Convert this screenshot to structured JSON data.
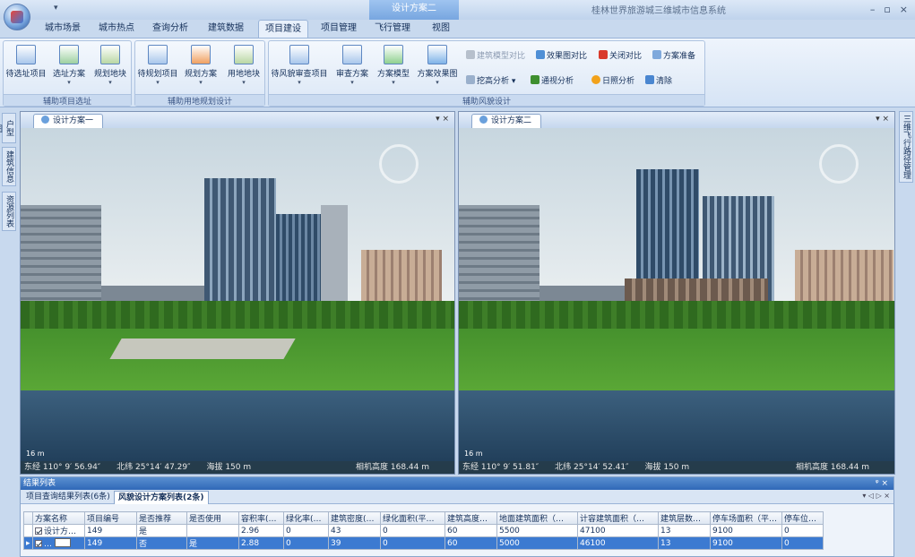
{
  "title_bar": {
    "context_tab": "设计方案二",
    "app_title": "桂林世界旅游城三维城市信息系统",
    "controls": [
      "–",
      "▫",
      "×"
    ],
    "qat_glyph": "▾"
  },
  "ribbon_tabs": [
    "城市场景",
    "城市热点",
    "查询分析",
    "建筑数据",
    "项目建设",
    "项目管理",
    "飞行管理",
    "视图"
  ],
  "active_tab": "项目建设",
  "groups": [
    {
      "label": "辅助项目选址",
      "buttons": [
        "待选址项目",
        "选址方案",
        "规划地块"
      ]
    },
    {
      "label": "辅助用地规划设计",
      "buttons": [
        "待规划项目",
        "规划方案",
        "用地地块"
      ]
    },
    {
      "label": "辅助风貌设计",
      "buttons": [
        "待风貌审查项目",
        "审查方案",
        "方案模型",
        "方案效果图"
      ]
    }
  ],
  "small_buttons": {
    "model_compare": "建筑模型对比",
    "effect_compare": "效果图对比",
    "close_compare": "关闭对比",
    "prepare": "方案准备",
    "cutfill": "挖高分析",
    "visibility": "通视分析",
    "sunlight": "日照分析",
    "clear": "清除"
  },
  "left_tabs": [
    "户型图",
    "建筑信息",
    "资源列表"
  ],
  "right_tab": "三维飞行路径管理",
  "panes": [
    {
      "tab_label": "设计方案一",
      "controls": "▾ ×",
      "scale": "16 m",
      "status": {
        "lon": "东经 110° 9′ 56.94″",
        "lat": "北纬 25°14′ 47.29″",
        "alt": "海拔 150 m",
        "cam": "相机高度 168.44 m"
      }
    },
    {
      "tab_label": "设计方案二",
      "controls": "▾ ×",
      "scale": "16 m",
      "status": {
        "lon": "东经 110° 9′ 51.81″",
        "lat": "北纬 25°14′ 52.41″",
        "alt": "海拔 150 m",
        "cam": "相机高度 168.44 m"
      }
    }
  ],
  "results": {
    "header": "结果列表",
    "pin": "ᵠ ×",
    "tabs": [
      "项目查询结果列表(6条)",
      "风貌设计方案列表(2条)"
    ],
    "active_tab": "风貌设计方案列表(2条)",
    "tab_nav": "▾ ◁ ▷ ×",
    "columns": [
      "方案名称",
      "项目编号",
      "是否推荐",
      "是否使用",
      "容积率(…",
      "绿化率(…",
      "建筑密度(…",
      "绿化面积(平…",
      "建筑高度…",
      "地面建筑面积（…",
      "计容建筑面积（…",
      "建筑层数…",
      "停车场面积（平…",
      "停车位…"
    ],
    "rows": [
      {
        "cells": [
          "设计方…",
          "149",
          "是",
          "",
          "2.96",
          "0",
          "43",
          "0",
          "60",
          "5500",
          "47100",
          "13",
          "9100",
          "0"
        ],
        "checked": true,
        "selected": false
      },
      {
        "cells": [
          "…",
          "149",
          "否",
          "是",
          "2.88",
          "0",
          "39",
          "0",
          "60",
          "5000",
          "46100",
          "13",
          "9100",
          "0"
        ],
        "checked": true,
        "selected": true
      }
    ]
  }
}
